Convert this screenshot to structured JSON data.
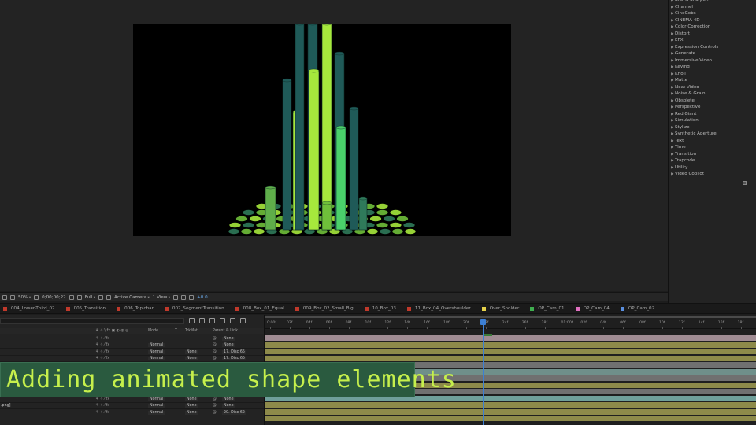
{
  "effects": {
    "items": [
      "Blur & Sharpen",
      "Channel",
      "CineGobs",
      "CINEMA 4D",
      "Color Correction",
      "Distort",
      "EFX",
      "Expression Controls",
      "Generate",
      "Immersive Video",
      "Keying",
      "Knoll",
      "Matte",
      "Neat Video",
      "Noise & Grain",
      "Obsolete",
      "Perspective",
      "Red Giant",
      "Simulation",
      "Stylize",
      "Synthetic Aperture",
      "Text",
      "Time",
      "Transition",
      "Trapcode",
      "Utility",
      "Video Copilot"
    ]
  },
  "toolbar": {
    "zoom": "50%",
    "timecode": "0;00;00;22",
    "resolution": "Full",
    "camera": "Active Camera",
    "view": "1 View",
    "exposure": "+0.0"
  },
  "tabs": [
    {
      "label": "004_Lower-Third_02",
      "color": "#c0392b"
    },
    {
      "label": "005_Transition",
      "color": "#c0392b"
    },
    {
      "label": "006_Topicbar",
      "color": "#c0392b"
    },
    {
      "label": "007_SegmentTransition",
      "color": "#c0392b"
    },
    {
      "label": "008_Box_01_Equal",
      "color": "#c0392b"
    },
    {
      "label": "009_Box_02_Small_Big",
      "color": "#c0392b"
    },
    {
      "label": "10_Box_03",
      "color": "#c0392b"
    },
    {
      "label": "11_Box_04_Overshoulder",
      "color": "#c0392b"
    },
    {
      "label": "Over_Sholder",
      "color": "#e5d14a"
    },
    {
      "label": "OP_Cam_01",
      "color": "#3fae4f"
    },
    {
      "label": "OP_Cam_04",
      "color": "#e070c0"
    },
    {
      "label": "OP_Cam_02",
      "color": "#5a8fe0"
    }
  ],
  "layer_header": {
    "mode": "Mode",
    "t": "T",
    "trkmat": "TrkMat",
    "parent": "Parent & Link"
  },
  "layers": [
    {
      "mode": "",
      "trkmat": "",
      "parent": "None",
      "name": ""
    },
    {
      "mode": "Normal",
      "trkmat": "",
      "parent": "None",
      "name": ""
    },
    {
      "mode": "Normal",
      "trkmat": "None",
      "parent": "17. Disc 65",
      "name": ""
    },
    {
      "mode": "Normal",
      "trkmat": "None",
      "parent": "17. Disc 65",
      "name": ""
    },
    {
      "mode": "Normal",
      "trkmat": "None",
      "parent": "None",
      "name": ""
    },
    {
      "mode": "Normal",
      "trkmat": "None",
      "parent": "None",
      "name": ".png]"
    },
    {
      "mode": "Normal",
      "trkmat": "None",
      "parent": "20. Disc 62",
      "name": ""
    }
  ],
  "ruler": {
    "ticks": [
      "0:00f",
      "02f",
      "04f",
      "06f",
      "08f",
      "10f",
      "12f",
      "14f",
      "16f",
      "18f",
      "20f",
      "22f",
      "24f",
      "26f",
      "28f",
      "01:00f",
      "02f",
      "04f",
      "06f",
      "08f",
      "10f",
      "12f",
      "14f",
      "16f",
      "18f",
      "20f"
    ]
  },
  "caption": {
    "text": "Adding animated shape elements"
  },
  "colors": {
    "accent": "#3c7fd4",
    "caption_bg": "#2a5a3f",
    "caption_text": "#c6f04c",
    "bright_green": "#a6e83c",
    "teal": "#1f5a58"
  }
}
